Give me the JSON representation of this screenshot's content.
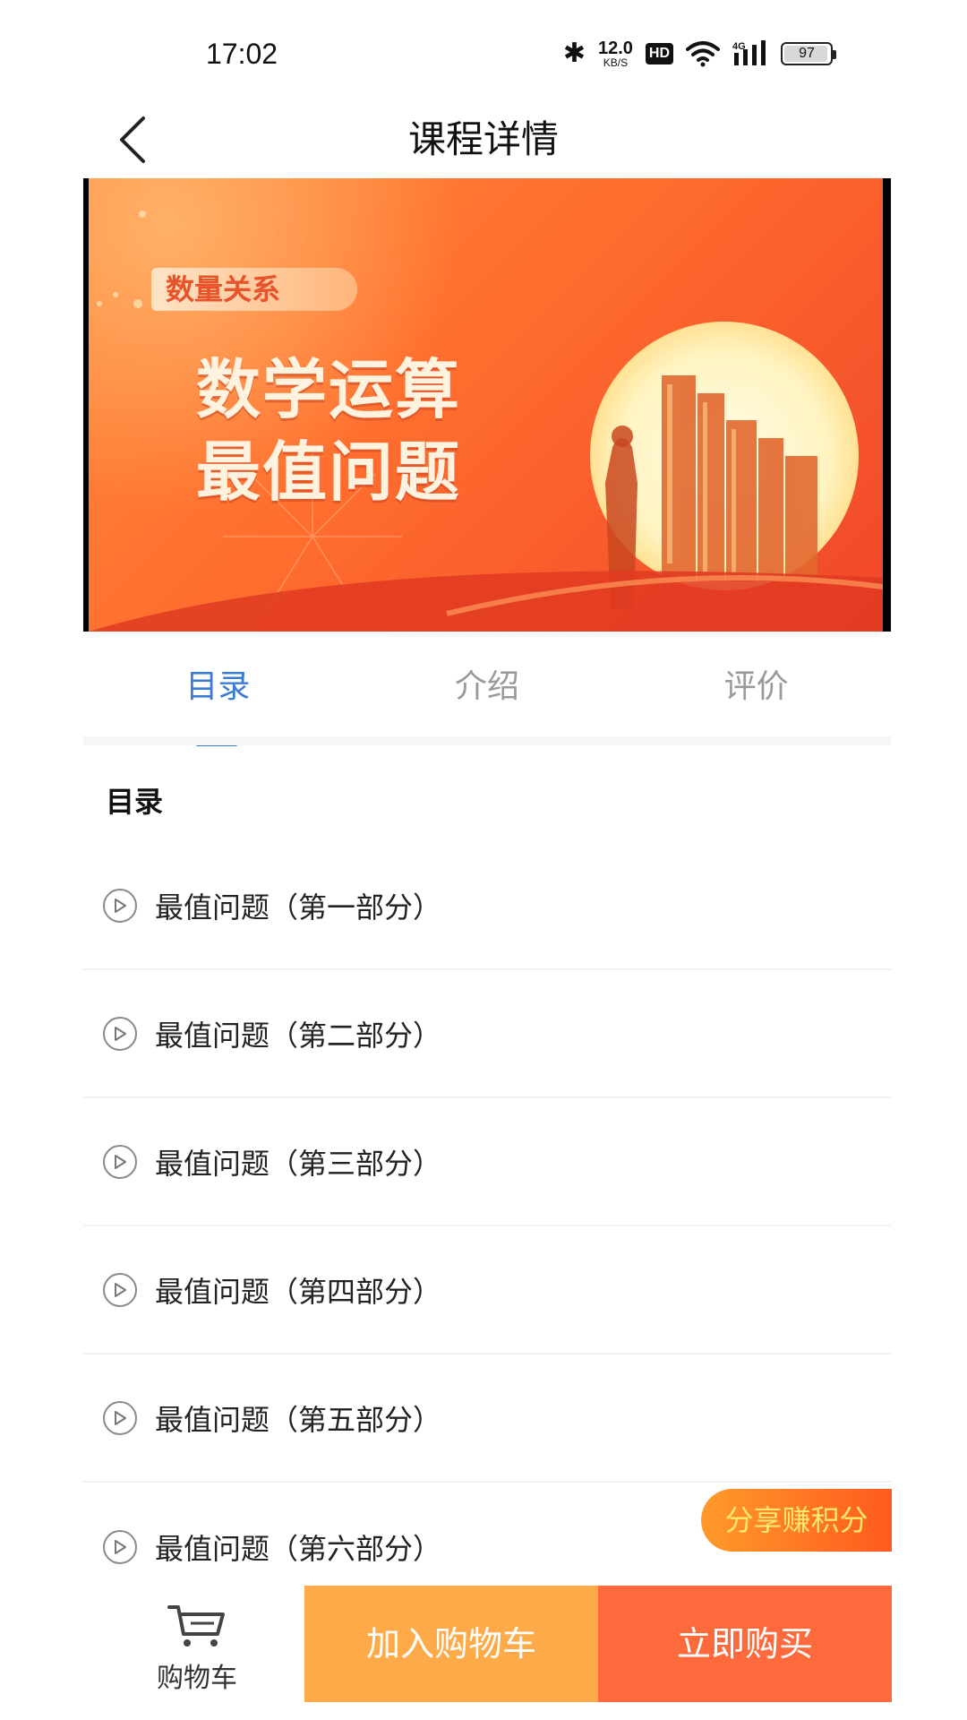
{
  "status_bar": {
    "time": "17:02",
    "net_speed_value": "12.0",
    "net_speed_unit": "KB/S",
    "hd_label": "HD",
    "network_type": "4G",
    "battery_percent": "97",
    "battery_level": 0.97
  },
  "header": {
    "title": "课程详情",
    "back_icon": "chevron-left-icon"
  },
  "banner": {
    "tag": "数量关系",
    "headline_line1": "数学运算",
    "headline_line2": "最值问题"
  },
  "tabs": [
    {
      "label": "目录",
      "active": true
    },
    {
      "label": "介绍",
      "active": false
    },
    {
      "label": "评价",
      "active": false
    }
  ],
  "catalog": {
    "title": "目录",
    "items": [
      {
        "label": "最值问题（第一部分）"
      },
      {
        "label": "最值问题（第二部分）"
      },
      {
        "label": "最值问题（第三部分）"
      },
      {
        "label": "最值问题（第四部分）"
      },
      {
        "label": "最值问题（第五部分）"
      },
      {
        "label": "最值问题（第六部分）"
      }
    ]
  },
  "share_badge": "分享赚积分",
  "bottom_bar": {
    "cart_label": "购物车",
    "add_to_cart": "加入购物车",
    "buy_now": "立即购买"
  },
  "colors": {
    "accent": "#3b7bd4",
    "add_to_cart_bg": "#ffaa48",
    "buy_now_bg": "#ff6a3d"
  }
}
